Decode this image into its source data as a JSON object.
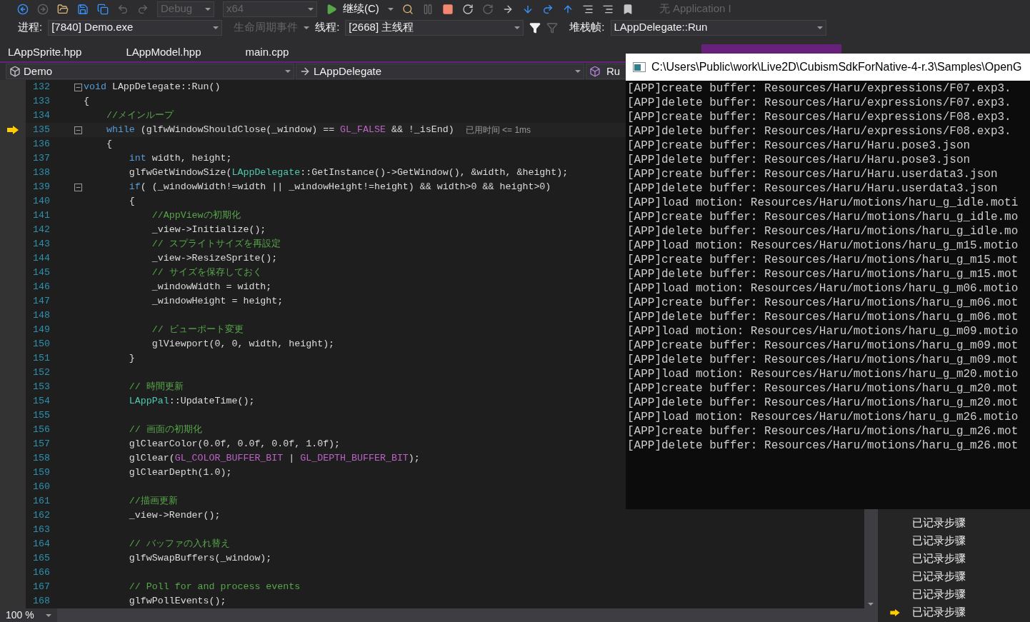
{
  "toolbar": {
    "configuration": {
      "value": "Debug",
      "disabled": true
    },
    "platform": {
      "value": "x64",
      "disabled": true
    },
    "continue_button": "继续(C)",
    "application_insights": "无 Application I"
  },
  "debug_location": {
    "process_label": "进程:",
    "process": "[7840] Demo.exe",
    "lifecycle_events": {
      "label": "生命周期事件",
      "disabled": true
    },
    "thread_label": "线程:",
    "thread": "[2668] 主线程",
    "stack_frame_label": "堆栈帧:",
    "stack_frame": "LAppDelegate::Run"
  },
  "tabs": [
    {
      "label": "LAppSprite.hpp",
      "selected": false
    },
    {
      "label": "LAppModel.hpp",
      "selected": false
    },
    {
      "label": "main.cpp",
      "selected": false
    }
  ],
  "navigation": {
    "project": "Demo",
    "scope": "LAppDelegate",
    "member": "Ru"
  },
  "editor": {
    "lines": [
      {
        "number": "132",
        "fold": true,
        "current": false,
        "tokens": [
          {
            "text": "void",
            "kind": "keyword"
          },
          {
            "text": " LAppDelegate::Run()",
            "kind": "plain"
          }
        ]
      },
      {
        "number": "133",
        "fold": false,
        "current": false,
        "tokens": [
          {
            "text": "{",
            "kind": "plain"
          }
        ]
      },
      {
        "number": "134",
        "fold": false,
        "current": false,
        "tokens": [
          {
            "text": "    //メインループ",
            "kind": "comment"
          }
        ]
      },
      {
        "number": "135",
        "fold": true,
        "current": true,
        "hint": "已用时间 <= 1ms",
        "tokens": [
          {
            "text": "    while",
            "kind": "keyword"
          },
          {
            "text": " (glfwWindowShouldClose(_window) == ",
            "kind": "plain"
          },
          {
            "text": "GL_FALSE",
            "kind": "macro"
          },
          {
            "text": " && !_isEnd)",
            "kind": "plain"
          }
        ]
      },
      {
        "number": "136",
        "fold": false,
        "current": false,
        "tokens": [
          {
            "text": "    {",
            "kind": "plain"
          }
        ]
      },
      {
        "number": "137",
        "fold": false,
        "current": false,
        "tokens": [
          {
            "text": "        int",
            "kind": "keyword"
          },
          {
            "text": " width, height;",
            "kind": "plain"
          }
        ]
      },
      {
        "number": "138",
        "fold": false,
        "current": false,
        "tokens": [
          {
            "text": "        glfwGetWindowSize(",
            "kind": "plain"
          },
          {
            "text": "LAppDelegate",
            "kind": "type"
          },
          {
            "text": "::GetInstance()->GetWindow(), &width, &height);",
            "kind": "plain"
          }
        ]
      },
      {
        "number": "139",
        "fold": true,
        "current": false,
        "tokens": [
          {
            "text": "        if",
            "kind": "keyword"
          },
          {
            "text": "( (_windowWidth!=width || _windowHeight!=height) && width>0 && height>0)",
            "kind": "plain"
          }
        ]
      },
      {
        "number": "140",
        "fold": false,
        "current": false,
        "tokens": [
          {
            "text": "        {",
            "kind": "plain"
          }
        ]
      },
      {
        "number": "141",
        "fold": false,
        "current": false,
        "tokens": [
          {
            "text": "            //AppViewの初期化",
            "kind": "comment"
          }
        ]
      },
      {
        "number": "142",
        "fold": false,
        "current": false,
        "tokens": [
          {
            "text": "            _view->Initialize();",
            "kind": "plain"
          }
        ]
      },
      {
        "number": "143",
        "fold": false,
        "current": false,
        "tokens": [
          {
            "text": "            // スプライトサイズを再設定",
            "kind": "comment"
          }
        ]
      },
      {
        "number": "144",
        "fold": false,
        "current": false,
        "tokens": [
          {
            "text": "            _view->ResizeSprite();",
            "kind": "plain"
          }
        ]
      },
      {
        "number": "145",
        "fold": false,
        "current": false,
        "tokens": [
          {
            "text": "            // サイズを保存しておく",
            "kind": "comment"
          }
        ]
      },
      {
        "number": "146",
        "fold": false,
        "current": false,
        "tokens": [
          {
            "text": "            _windowWidth = width;",
            "kind": "plain"
          }
        ]
      },
      {
        "number": "147",
        "fold": false,
        "current": false,
        "tokens": [
          {
            "text": "            _windowHeight = height;",
            "kind": "plain"
          }
        ]
      },
      {
        "number": "148",
        "fold": false,
        "current": false
      },
      {
        "number": "149",
        "fold": false,
        "current": false,
        "tokens": [
          {
            "text": "            // ビューポート変更",
            "kind": "comment"
          }
        ]
      },
      {
        "number": "150",
        "fold": false,
        "current": false,
        "tokens": [
          {
            "text": "            glViewport(0, 0, width, height);",
            "kind": "plain"
          }
        ]
      },
      {
        "number": "151",
        "fold": false,
        "current": false,
        "tokens": [
          {
            "text": "        }",
            "kind": "plain"
          }
        ]
      },
      {
        "number": "152",
        "fold": false,
        "current": false
      },
      {
        "number": "153",
        "fold": false,
        "current": false,
        "tokens": [
          {
            "text": "        // 時間更新",
            "kind": "comment"
          }
        ]
      },
      {
        "number": "154",
        "fold": false,
        "current": false,
        "tokens": [
          {
            "text": "        LAppPal",
            "kind": "type"
          },
          {
            "text": "::UpdateTime();",
            "kind": "plain"
          }
        ]
      },
      {
        "number": "155",
        "fold": false,
        "current": false
      },
      {
        "number": "156",
        "fold": false,
        "current": false,
        "tokens": [
          {
            "text": "        // 画面の初期化",
            "kind": "comment"
          }
        ]
      },
      {
        "number": "157",
        "fold": false,
        "current": false,
        "tokens": [
          {
            "text": "        glClearColor(0.0f, 0.0f, 0.0f, 1.0f);",
            "kind": "plain"
          }
        ]
      },
      {
        "number": "158",
        "fold": false,
        "current": false,
        "tokens": [
          {
            "text": "        glClear(",
            "kind": "plain"
          },
          {
            "text": "GL_COLOR_BUFFER_BIT",
            "kind": "macro"
          },
          {
            "text": " | ",
            "kind": "plain"
          },
          {
            "text": "GL_DEPTH_BUFFER_BIT",
            "kind": "macro"
          },
          {
            "text": ");",
            "kind": "plain"
          }
        ]
      },
      {
        "number": "159",
        "fold": false,
        "current": false,
        "tokens": [
          {
            "text": "        glClearDepth(1.0);",
            "kind": "plain"
          }
        ]
      },
      {
        "number": "160",
        "fold": false,
        "current": false
      },
      {
        "number": "161",
        "fold": false,
        "current": false,
        "tokens": [
          {
            "text": "        //描画更新",
            "kind": "comment"
          }
        ]
      },
      {
        "number": "162",
        "fold": false,
        "current": false,
        "tokens": [
          {
            "text": "        _view->Render();",
            "kind": "plain"
          }
        ]
      },
      {
        "number": "163",
        "fold": false,
        "current": false
      },
      {
        "number": "164",
        "fold": false,
        "current": false,
        "tokens": [
          {
            "text": "        // バッファの入れ替え",
            "kind": "comment"
          }
        ]
      },
      {
        "number": "165",
        "fold": false,
        "current": false,
        "tokens": [
          {
            "text": "        glfwSwapBuffers(_window);",
            "kind": "plain"
          }
        ]
      },
      {
        "number": "166",
        "fold": false,
        "current": false
      },
      {
        "number": "167",
        "fold": false,
        "current": false,
        "tokens": [
          {
            "text": "        // Poll for and process events",
            "kind": "comment"
          }
        ]
      },
      {
        "number": "168",
        "fold": false,
        "current": false,
        "tokens": [
          {
            "text": "        glfwPollEvents();",
            "kind": "plain"
          }
        ]
      }
    ]
  },
  "status": {
    "zoom": "100 %"
  },
  "steps_panel": {
    "items": [
      {
        "label": "已记录步骤",
        "current": false
      },
      {
        "label": "已记录步骤",
        "current": false
      },
      {
        "label": "已记录步骤",
        "current": false
      },
      {
        "label": "已记录步骤",
        "current": false
      },
      {
        "label": "已记录步骤",
        "current": false
      },
      {
        "label": "已记录步骤",
        "current": true
      }
    ]
  },
  "console": {
    "title": "C:\\Users\\Public\\work\\Live2D\\CubismSdkForNative-4-r.3\\Samples\\OpenG",
    "lines": [
      "[APP]create buffer: Resources/Haru/expressions/F07.exp3.",
      "[APP]delete buffer: Resources/Haru/expressions/F07.exp3.",
      "[APP]create buffer: Resources/Haru/expressions/F08.exp3.",
      "[APP]delete buffer: Resources/Haru/expressions/F08.exp3.",
      "[APP]create buffer: Resources/Haru/Haru.pose3.json",
      "[APP]delete buffer: Resources/Haru/Haru.pose3.json",
      "[APP]create buffer: Resources/Haru/Haru.userdata3.json",
      "[APP]delete buffer: Resources/Haru/Haru.userdata3.json",
      "[APP]load motion: Resources/Haru/motions/haru_g_idle.moti",
      "[APP]create buffer: Resources/Haru/motions/haru_g_idle.mo",
      "[APP]delete buffer: Resources/Haru/motions/haru_g_idle.mo",
      "[APP]load motion: Resources/Haru/motions/haru_g_m15.motio",
      "[APP]create buffer: Resources/Haru/motions/haru_g_m15.mot",
      "[APP]delete buffer: Resources/Haru/motions/haru_g_m15.mot",
      "[APP]load motion: Resources/Haru/motions/haru_g_m06.motio",
      "[APP]create buffer: Resources/Haru/motions/haru_g_m06.mot",
      "[APP]delete buffer: Resources/Haru/motions/haru_g_m06.mot",
      "[APP]load motion: Resources/Haru/motions/haru_g_m09.motio",
      "[APP]create buffer: Resources/Haru/motions/haru_g_m09.mot",
      "[APP]delete buffer: Resources/Haru/motions/haru_g_m09.mot",
      "[APP]load motion: Resources/Haru/motions/haru_g_m20.motio",
      "[APP]create buffer: Resources/Haru/motions/haru_g_m20.mot",
      "[APP]delete buffer: Resources/Haru/motions/haru_g_m20.mot",
      "[APP]load motion: Resources/Haru/motions/haru_g_m26.motio",
      "[APP]create buffer: Resources/Haru/motions/haru_g_m26.mot",
      "[APP]delete buffer: Resources/Haru/motions/haru_g_m26.mot"
    ]
  }
}
